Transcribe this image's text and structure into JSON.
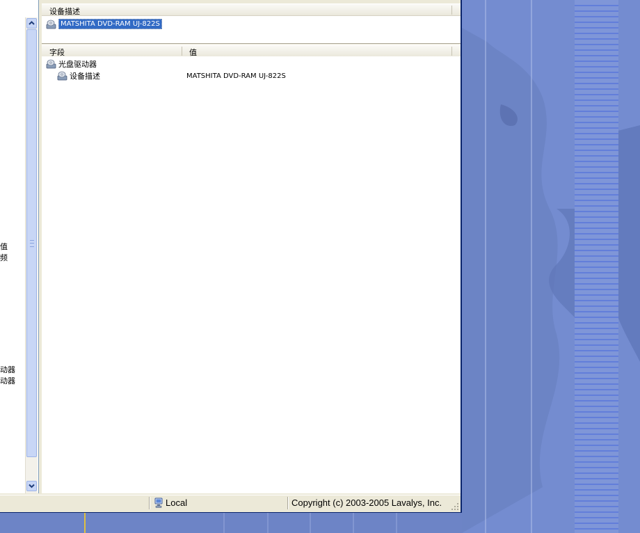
{
  "left_pane": {
    "fragments": [
      "值",
      "频",
      "",
      "动器",
      "动器"
    ]
  },
  "top_list": {
    "column_header": "设备描述",
    "selected_item": "MATSHITA DVD-RAM UJ-822S"
  },
  "details": {
    "columns": {
      "field": "字段",
      "value": "值"
    },
    "group": "光盘驱动器",
    "rows": [
      {
        "field": "设备描述",
        "value": "MATSHITA DVD-RAM UJ-822S"
      }
    ]
  },
  "status_bar": {
    "location": "Local",
    "copyright": "Copyright (c) 2003-2005 Lavalys, Inc."
  },
  "icons": {
    "drive": "optical-drive-icon",
    "computer": "computer-icon",
    "scroll_up": "chevron-up-icon",
    "scroll_down": "chevron-down-icon"
  },
  "colors": {
    "selection": "#316ac5",
    "desktop": "#6f86c8",
    "window_face": "#ece9d8"
  }
}
